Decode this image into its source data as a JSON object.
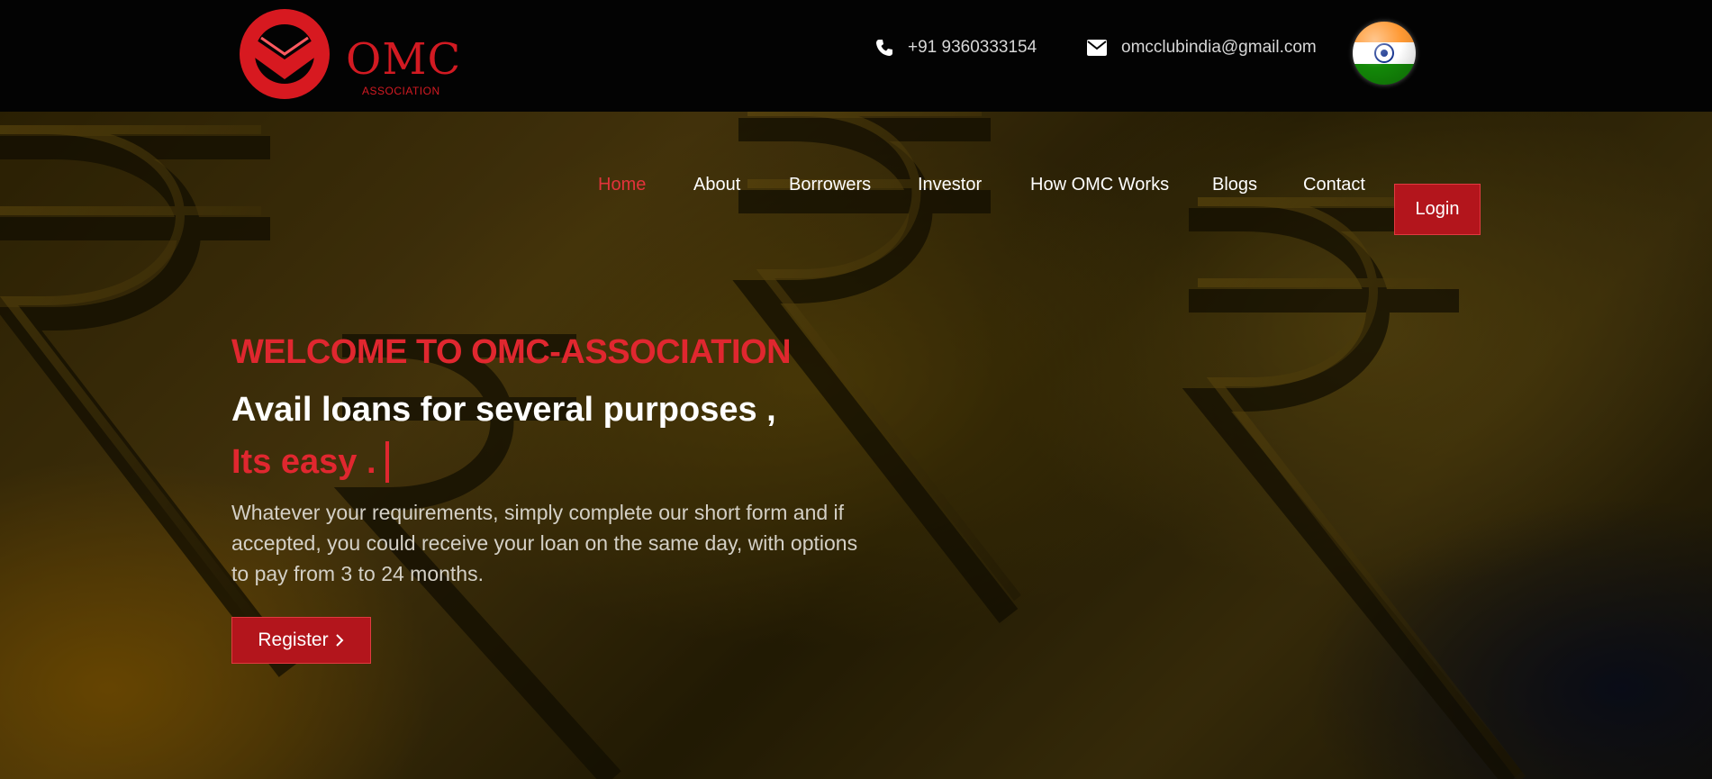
{
  "header": {
    "logo_text": "OMC",
    "logo_subtext": "ASSOCIATION",
    "phone": "+91 9360333154",
    "email": "omcclubindia@gmail.com",
    "flag_icon": "india-flag-icon"
  },
  "nav": {
    "items": [
      {
        "label": "Home",
        "active": true
      },
      {
        "label": "About"
      },
      {
        "label": "Borrowers"
      },
      {
        "label": "Investor"
      },
      {
        "label": "How OMC Works"
      },
      {
        "label": "Blogs"
      },
      {
        "label": "Contact"
      }
    ],
    "login_label": "Login"
  },
  "hero": {
    "welcome": "WELCOME TO OMC-ASSOCIATION",
    "headline": "Avail loans for several purposes ,",
    "subhead": "Its easy .",
    "description": "Whatever your requirements, simply complete our short form and if accepted, you could receive your loan on the same day, with options to pay from 3 to 24 months.",
    "register_label": "Register",
    "register_icon": "chevron-right-icon"
  },
  "colors": {
    "accent": "#e0272f",
    "button": "#b3151c",
    "topbar": "#030303"
  }
}
